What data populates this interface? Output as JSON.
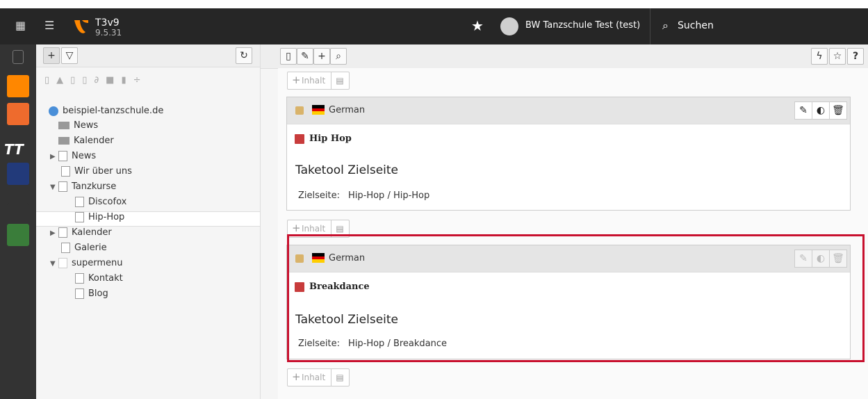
{
  "brand": {
    "name": "T3v9",
    "version": "9.5.31"
  },
  "user": {
    "name": "BW Tanzschule Test (test)"
  },
  "search": {
    "label": "Suchen"
  },
  "tree": {
    "root": "beispiel-tanzschule.de",
    "nodes": [
      {
        "label": "News"
      },
      {
        "label": "Kalender"
      },
      {
        "label": "News"
      },
      {
        "label": "Wir über uns"
      },
      {
        "label": "Tanzkurse"
      },
      {
        "label": "Discofox"
      },
      {
        "label": "Hip-Hop"
      },
      {
        "label": "Kalender"
      },
      {
        "label": "Galerie"
      },
      {
        "label": "supermenu"
      },
      {
        "label": "Kontakt"
      },
      {
        "label": "Blog"
      }
    ]
  },
  "content": {
    "new_content_label": "Inhalt",
    "elements": [
      {
        "language": "German",
        "type": "Hip Hop",
        "heading": "Taketool Zielseite",
        "target_label": "Zielseite:",
        "target": "Hip-Hop / Hip-Hop"
      },
      {
        "language": "German",
        "type": "Breakdance",
        "heading": "Taketool Zielseite",
        "target_label": "Zielseite:",
        "target": "Hip-Hop / Breakdance"
      }
    ]
  },
  "colors": {
    "highlight": "#c8102e",
    "accent": "#ff8700"
  }
}
